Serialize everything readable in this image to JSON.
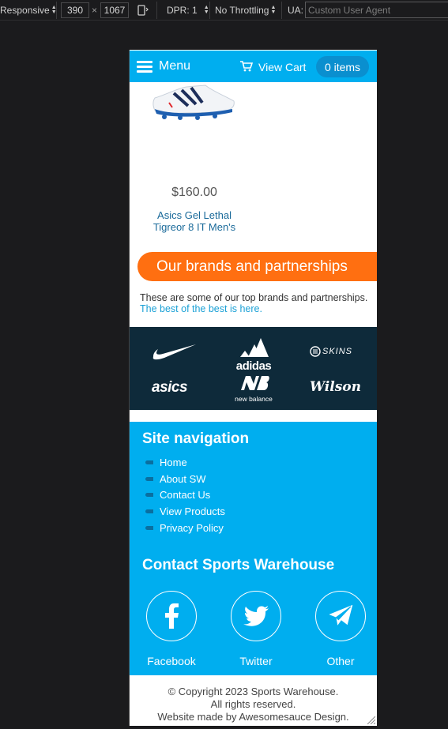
{
  "devtools": {
    "device": "Responsive",
    "width": "390",
    "times": "×",
    "height": "1067",
    "dpr": "DPR: 1",
    "throttling": "No Throttling",
    "ua_label": "UA:",
    "ua_placeholder": "Custom User Agent"
  },
  "header": {
    "menu_label": "Menu",
    "cart_label": "View Cart",
    "cart_count": "0 items"
  },
  "product": {
    "price": "$160.00",
    "name": "Asics Gel Lethal Tigreor 8 IT Men's"
  },
  "brands": {
    "heading": "Our brands and partnerships",
    "text": "These are some of our top brands and partnerships.",
    "link": "The best of the best is here.",
    "logos": {
      "adidas": "adidas",
      "skins": "SKINS",
      "asics": "asics",
      "newbalance": "new balance",
      "wilson": "Wilson"
    }
  },
  "footer": {
    "nav_heading": "Site navigation",
    "nav_items": [
      "Home",
      "About SW",
      "Contact Us",
      "View Products",
      "Privacy Policy"
    ],
    "contact_heading": "Contact Sports Warehouse",
    "social": [
      "Facebook",
      "Twitter",
      "Other"
    ]
  },
  "copyright": {
    "line1": "© Copyright 2023 Sports Warehouse.",
    "line2": "All rights reserved.",
    "line3": "Website made by Awesomesauce Design."
  },
  "colors": {
    "primary": "#00aeef",
    "accent": "#ff6f11",
    "logo_band": "#0e2a3a"
  }
}
